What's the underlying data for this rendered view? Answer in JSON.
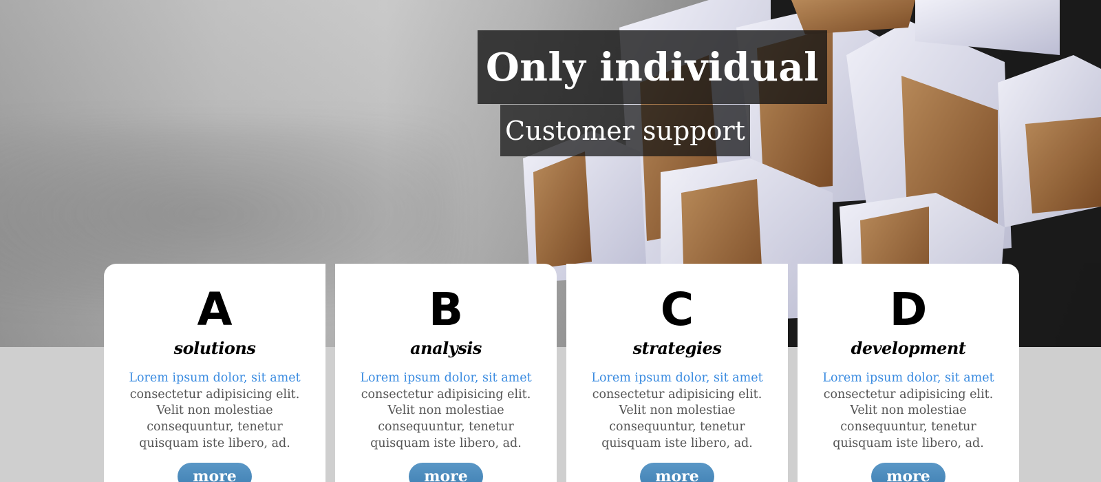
{
  "hero": {
    "headline": "Only individual",
    "subheadline": "Customer support"
  },
  "colors": {
    "link_blue": "#3a8be0",
    "button_blue": "#4a89bb",
    "page_bg": "#cfcfcf"
  },
  "cards": [
    {
      "letter": "A",
      "tag": "solutions",
      "lead": "Lorem ipsum dolor, sit amet",
      "text": "consectetur adipisicing elit. Velit non molestiae consequuntur, tenetur quisquam iste libero, ad.",
      "button": "more"
    },
    {
      "letter": "B",
      "tag": "analysis",
      "lead": "Lorem ipsum dolor, sit amet",
      "text": "consectetur adipisicing elit. Velit non molestiae consequuntur, tenetur quisquam iste libero, ad.",
      "button": "more"
    },
    {
      "letter": "C",
      "tag": "strategies",
      "lead": "Lorem ipsum dolor, sit amet",
      "text": "consectetur adipisicing elit. Velit non molestiae consequuntur, tenetur quisquam iste libero, ad.",
      "button": "more"
    },
    {
      "letter": "D",
      "tag": "development",
      "lead": "Lorem ipsum dolor, sit amet",
      "text": "consectetur adipisicing elit. Velit non molestiae consequuntur, tenetur quisquam iste libero, ad.",
      "button": "more"
    }
  ]
}
